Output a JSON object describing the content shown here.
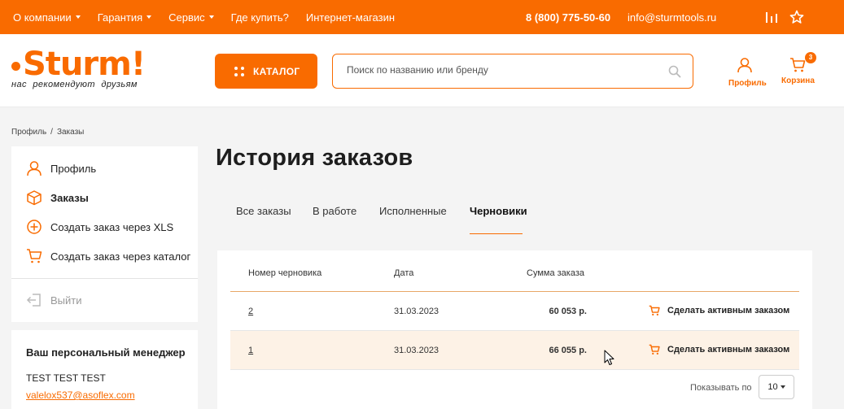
{
  "topbar": {
    "nav": [
      {
        "label": "О компании",
        "has_dropdown": true
      },
      {
        "label": "Гарантия",
        "has_dropdown": true
      },
      {
        "label": "Сервис",
        "has_dropdown": true
      },
      {
        "label": "Где купить?",
        "has_dropdown": false
      },
      {
        "label": "Интернет-магазин",
        "has_dropdown": false
      }
    ],
    "phone": "8 (800) 775-50-60",
    "email": "info@sturmtools.ru",
    "icons": [
      "compare-icon",
      "favorites-star-icon"
    ]
  },
  "header": {
    "logo_text": "Sturm!",
    "slogan": "нас рекомендуют друзьям",
    "catalog_label": "КАТАЛОГ",
    "search_placeholder": "Поиск по названию или бренду",
    "profile_label": "Профиль",
    "cart_label": "Корзина",
    "cart_count": "3"
  },
  "breadcrumb": {
    "items": [
      "Профиль",
      "Заказы"
    ],
    "separator": "/"
  },
  "sidebar": {
    "items": [
      {
        "label": "Профиль",
        "icon": "user-icon",
        "active": false
      },
      {
        "label": "Заказы",
        "icon": "box-icon",
        "active": true
      },
      {
        "label": "Создать заказ через XLS",
        "icon": "plus-circle-icon",
        "active": false
      },
      {
        "label": "Создать заказ через каталог",
        "icon": "cart-icon",
        "active": false
      }
    ],
    "logout_label": "Выйти"
  },
  "manager": {
    "title": "Ваш персональный менеджер",
    "name": "TEST TEST TEST",
    "email": "valelox537@asoflex.com"
  },
  "main": {
    "title": "История заказов",
    "tabs": [
      {
        "label": "Все заказы",
        "active": false
      },
      {
        "label": "В работе",
        "active": false
      },
      {
        "label": "Исполненные",
        "active": false
      },
      {
        "label": "Черновики",
        "active": true
      }
    ],
    "table": {
      "headers": {
        "number": "Номер черновика",
        "date": "Дата",
        "sum": "Сумма заказа"
      },
      "rows": [
        {
          "number": "2",
          "date": "31.03.2023",
          "sum": "60 053 р.",
          "action": "Сделать активным заказом",
          "highlighted": false
        },
        {
          "number": "1",
          "date": "31.03.2023",
          "sum": "66 055 р.",
          "action": "Сделать активным заказом",
          "highlighted": true
        }
      ]
    },
    "pagination": {
      "per_page_label": "Показывать по",
      "per_page_value": "10"
    }
  },
  "colors": {
    "accent": "#f96b00",
    "row_highlight": "#fdf2e6"
  }
}
